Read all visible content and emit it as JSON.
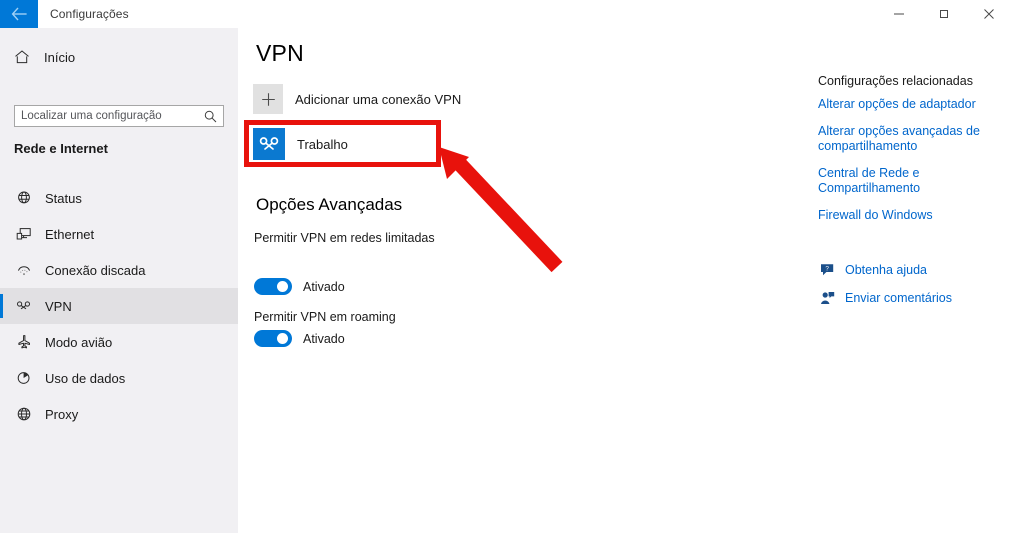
{
  "window": {
    "title": "Configurações",
    "back_icon": "back-arrow-icon",
    "minimize_label": "Minimizar",
    "maximize_label": "Maximizar",
    "close_label": "Fechar"
  },
  "sidebar": {
    "home": {
      "label": "Início",
      "icon": "home-icon"
    },
    "search": {
      "placeholder": "Localizar uma configuração",
      "value": "",
      "icon": "search-icon"
    },
    "section_heading": "Rede e Internet",
    "items": [
      {
        "label": "Status",
        "icon": "globe-status-icon",
        "selected": false
      },
      {
        "label": "Ethernet",
        "icon": "ethernet-icon",
        "selected": false
      },
      {
        "label": "Conexão discada",
        "icon": "dialup-icon",
        "selected": false
      },
      {
        "label": "VPN",
        "icon": "vpn-icon",
        "selected": true
      },
      {
        "label": "Modo avião",
        "icon": "airplane-icon",
        "selected": false
      },
      {
        "label": "Uso de dados",
        "icon": "data-usage-icon",
        "selected": false
      },
      {
        "label": "Proxy",
        "icon": "proxy-globe-icon",
        "selected": false
      }
    ]
  },
  "main": {
    "page_title": "VPN",
    "add_connection": {
      "label": "Adicionar uma conexão VPN",
      "icon": "plus-icon"
    },
    "connections": [
      {
        "name": "Trabalho",
        "icon": "vpn-connection-icon",
        "highlighted": true
      }
    ],
    "advanced": {
      "title": "Opções Avançadas",
      "options": [
        {
          "label": "Permitir VPN em redes limitadas",
          "state_label": "Ativado",
          "on": true
        },
        {
          "label": "Permitir VPN em roaming",
          "state_label": "Ativado",
          "on": true
        }
      ]
    }
  },
  "related": {
    "heading": "Configurações relacionadas",
    "links": [
      "Alterar opções de adaptador",
      "Alterar opções avançadas de compartilhamento",
      "Central de Rede e Compartilhamento",
      "Firewall do Windows"
    ],
    "help": [
      {
        "label": "Obtenha ajuda",
        "icon": "help-question-icon"
      },
      {
        "label": "Enviar comentários",
        "icon": "feedback-person-icon"
      }
    ]
  },
  "annotation": {
    "box_target": "Trabalho",
    "arrow_color": "#e8120c",
    "box_color": "#e8120c"
  },
  "colors": {
    "accent": "#0078d7",
    "link": "#0066cc",
    "sidebar_bg": "#f1f0f3",
    "annotation_red": "#e8120c"
  }
}
